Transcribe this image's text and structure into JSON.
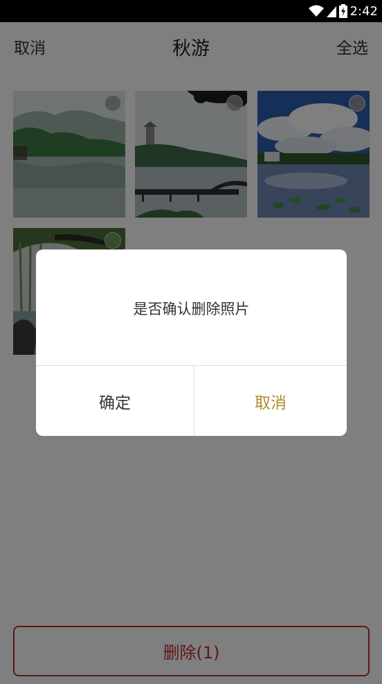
{
  "status_bar": {
    "time": "2:42"
  },
  "header": {
    "cancel_label": "取消",
    "title": "秋游",
    "select_all_label": "全选"
  },
  "photos": [
    {
      "scene": "misty lake with green hills"
    },
    {
      "scene": "pagoda over lake with pier"
    },
    {
      "scene": "lake with cumulus clouds and lotus"
    },
    {
      "scene": "willow tree by lakeside"
    }
  ],
  "delete_button": {
    "label": "删除(1)"
  },
  "dialog": {
    "message": "是否确认删除照片",
    "confirm_label": "确定",
    "cancel_label": "取消",
    "cancel_color": "#b38a2e"
  },
  "colors": {
    "delete_accent": "#c42a2a"
  }
}
